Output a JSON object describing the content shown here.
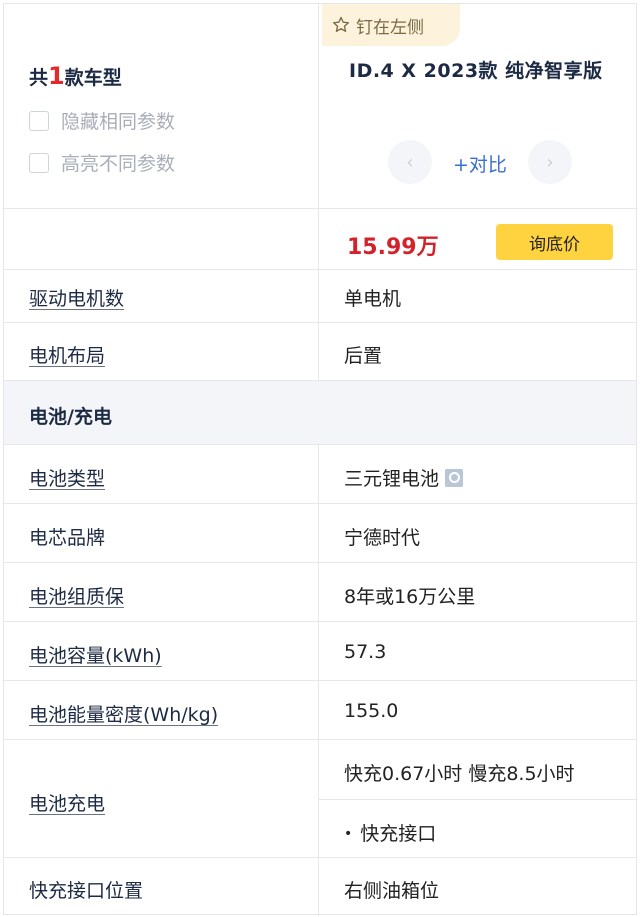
{
  "header": {
    "count_prefix": "共",
    "count_number": "1",
    "count_suffix": "款车型",
    "hide_same_label": "隐藏相同参数",
    "highlight_diff_label": "高亮不同参数",
    "pin_label": "钉在左侧",
    "model_name": "ID.4 X 2023款 纯净智享版",
    "compare_label": "+对比",
    "prev_arrow": "‹",
    "next_arrow": "›"
  },
  "price": {
    "value": "15.99万",
    "button_label": "询底价"
  },
  "params": {
    "motor_count": {
      "label": "驱动电机数",
      "value": "单电机"
    },
    "motor_layout": {
      "label": "电机布局",
      "value": "后置"
    }
  },
  "section": {
    "title": "电池/充电"
  },
  "battery": {
    "type": {
      "label": "电池类型",
      "value": "三元锂电池"
    },
    "cell_brand": {
      "label": "电芯品牌",
      "value": "宁德时代"
    },
    "warranty": {
      "label": "电池组质保",
      "value": "8年或16万公里"
    },
    "capacity": {
      "label": "电池容量(kWh)",
      "value": "57.3"
    },
    "density": {
      "label": "电池能量密度(Wh/kg)",
      "value": "155.0"
    },
    "charging": {
      "label": "电池充电",
      "value": "快充0.67小时 慢充8.5小时",
      "sub_value": "快充接口"
    },
    "port_location": {
      "label": "快充接口位置",
      "value": "右侧油箱位"
    }
  },
  "colors": {
    "accent_red": "#d3232a",
    "link_blue": "#3b6fd1",
    "button_yellow": "#ffd23f",
    "section_bg": "#f3f5f9"
  },
  "icons": [
    "star-pin-icon",
    "checkbox-icon",
    "chevron-left-icon",
    "chevron-right-icon",
    "search-icon",
    "bullet-icon"
  ]
}
